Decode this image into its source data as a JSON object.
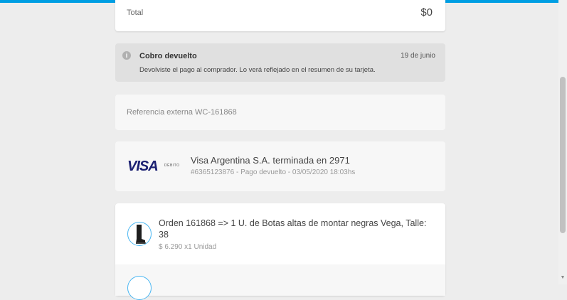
{
  "total": {
    "label": "Total",
    "value": "$0"
  },
  "notice": {
    "icon": "info-icon",
    "title": "Cobro devuelto",
    "date": "19 de junio",
    "text": "Devolviste el pago al comprador. Lo verá reflejado en el resumen de su tarjeta."
  },
  "reference": {
    "text": "Referencia externa WC-161868"
  },
  "payment": {
    "card_brand": "VISA",
    "card_type": "DÉBITO",
    "title": "Visa Argentina S.A. terminada en 2971",
    "subtitle": "#6365123876 - Pago devuelto - 03/05/2020 18:03hs"
  },
  "order": {
    "title": "Orden 161868 => 1 U. de Botas altas de montar negras Vega, Talle: 38",
    "subtitle": "$ 6.290 x1 Unidad"
  },
  "colors": {
    "accent": "#009ee3",
    "visa": "#1a1f71",
    "avatar_border": "#49b6f2"
  }
}
